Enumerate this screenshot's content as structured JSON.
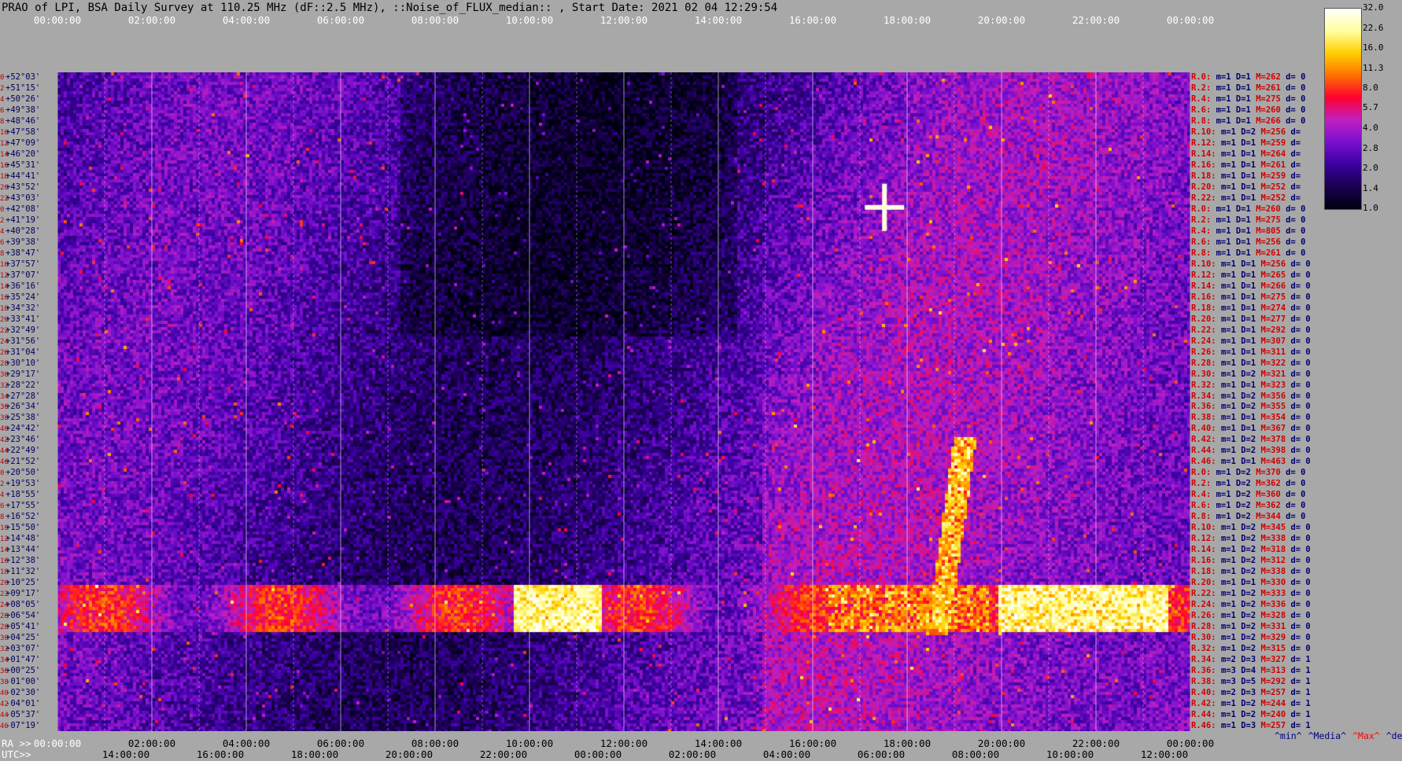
{
  "title": "PRAO of LPI, BSA Daily Survey at 110.25 MHz (dF::2.5 MHz), ::Noise_of_FLUX_median:: , Start Date: 2021 02 04 12:29:54",
  "chart_data": {
    "type": "heatmap",
    "top_ticks": [
      "00:00:00",
      "02:00:00",
      "04:00:00",
      "06:00:00",
      "08:00:00",
      "10:00:00",
      "12:00:00",
      "14:00:00",
      "16:00:00",
      "18:00:00",
      "20:00:00",
      "22:00:00",
      "00:00:00"
    ],
    "ra_prefix": "RA >>",
    "ra_ticks": [
      "00:00:00",
      "02:00:00",
      "04:00:00",
      "06:00:00",
      "08:00:00",
      "10:00:00",
      "12:00:00",
      "14:00:00",
      "16:00:00",
      "18:00:00",
      "20:00:00",
      "22:00:00",
      "00:00:00"
    ],
    "utc_prefix": "UTC>>",
    "utc_ticks": [
      "14:00:00",
      "16:00:00",
      "18:00:00",
      "20:00:00",
      "22:00:00",
      "00:00:00",
      "02:00:00",
      "04:00:00",
      "06:00:00",
      "08:00:00",
      "10:00:00",
      "12:00:00"
    ],
    "declinations": [
      "+52°03'",
      "+51°15'",
      "+50°26'",
      "+49°38'",
      "+48°46'",
      "+47°58'",
      "+47°09'",
      "+46°20'",
      "+45°31'",
      "+44°41'",
      "+43°52'",
      "+43°03'",
      "+42°08'",
      "+41°19'",
      "+40°28'",
      "+39°38'",
      "+38°47'",
      "+37°57'",
      "+37°07'",
      "+36°16'",
      "+35°24'",
      "+34°32'",
      "+33°41'",
      "+32°49'",
      "+31°56'",
      "+31°04'",
      "+30°10'",
      "+29°17'",
      "+28°22'",
      "+27°28'",
      "+26°34'",
      "+25°38'",
      "+24°42'",
      "+23°46'",
      "+22°49'",
      "+21°52'",
      "+20°50'",
      "+19°53'",
      "+18°55'",
      "+17°55'",
      "+16°52'",
      "+15°50'",
      "+14°48'",
      "+13°44'",
      "+12°38'",
      "+11°32'",
      "+10°25'",
      "+09°17'",
      "+08°05'",
      "+06°54'",
      "+05°41'",
      "+04°25'",
      "+03°07'",
      "+01°47'",
      "+00°25'",
      "-01°00'",
      "-02°30'",
      "-04°01'",
      "-05°37'",
      "-07°19'"
    ],
    "row_index": [
      "0",
      "2",
      "4",
      "6",
      "8",
      "10",
      "12",
      "14",
      "16",
      "18",
      "20",
      "22",
      "0",
      "2",
      "4",
      "6",
      "8",
      "10",
      "12",
      "14",
      "16",
      "18",
      "20",
      "22",
      "24",
      "26",
      "28",
      "30",
      "32",
      "34",
      "36",
      "38",
      "40",
      "42",
      "44",
      "46",
      "0",
      "2",
      "4",
      "6",
      "8",
      "10",
      "12",
      "14",
      "16",
      "18",
      "20",
      "22",
      "24",
      "26",
      "28",
      "30",
      "32",
      "34",
      "36",
      "38",
      "40",
      "42",
      "44",
      "46"
    ],
    "row_stats": [
      {
        "r": "R.0:",
        "m": "m=1",
        "D": "D=1",
        "M": "M=262",
        "d": "d= 0"
      },
      {
        "r": "R.2:",
        "m": "m=1",
        "D": "D=1",
        "M": "M=261",
        "d": "d= 0"
      },
      {
        "r": "R.4:",
        "m": "m=1",
        "D": "D=1",
        "M": "M=275",
        "d": "d= 0"
      },
      {
        "r": "R.6:",
        "m": "m=1",
        "D": "D=1",
        "M": "M=260",
        "d": "d= 0"
      },
      {
        "r": "R.8:",
        "m": "m=1",
        "D": "D=1",
        "M": "M=266",
        "d": "d= 0"
      },
      {
        "r": "R.10:",
        "m": "m=1",
        "D": "D=2",
        "M": "M=256",
        "d": "d="
      },
      {
        "r": "R.12:",
        "m": "m=1",
        "D": "D=1",
        "M": "M=259",
        "d": "d="
      },
      {
        "r": "R.14:",
        "m": "m=1",
        "D": "D=1",
        "M": "M=264",
        "d": "d="
      },
      {
        "r": "R.16:",
        "m": "m=1",
        "D": "D=1",
        "M": "M=261",
        "d": "d="
      },
      {
        "r": "R.18:",
        "m": "m=1",
        "D": "D=1",
        "M": "M=259",
        "d": "d="
      },
      {
        "r": "R.20:",
        "m": "m=1",
        "D": "D=1",
        "M": "M=252",
        "d": "d="
      },
      {
        "r": "R.22:",
        "m": "m=1",
        "D": "D=1",
        "M": "M=252",
        "d": "d="
      },
      {
        "r": "R.0:",
        "m": "m=1",
        "D": "D=1",
        "M": "M=260",
        "d": "d= 0"
      },
      {
        "r": "R.2:",
        "m": "m=1",
        "D": "D=1",
        "M": "M=275",
        "d": "d= 0"
      },
      {
        "r": "R.4:",
        "m": "m=1",
        "D": "D=1",
        "M": "M=805",
        "d": "d= 0"
      },
      {
        "r": "R.6:",
        "m": "m=1",
        "D": "D=1",
        "M": "M=256",
        "d": "d= 0"
      },
      {
        "r": "R.8:",
        "m": "m=1",
        "D": "D=1",
        "M": "M=261",
        "d": "d= 0"
      },
      {
        "r": "R.10:",
        "m": "m=1",
        "D": "D=1",
        "M": "M=256",
        "d": "d= 0"
      },
      {
        "r": "R.12:",
        "m": "m=1",
        "D": "D=1",
        "M": "M=265",
        "d": "d= 0"
      },
      {
        "r": "R.14:",
        "m": "m=1",
        "D": "D=1",
        "M": "M=266",
        "d": "d= 0"
      },
      {
        "r": "R.16:",
        "m": "m=1",
        "D": "D=1",
        "M": "M=275",
        "d": "d= 0"
      },
      {
        "r": "R.18:",
        "m": "m=1",
        "D": "D=1",
        "M": "M=274",
        "d": "d= 0"
      },
      {
        "r": "R.20:",
        "m": "m=1",
        "D": "D=1",
        "M": "M=277",
        "d": "d= 0"
      },
      {
        "r": "R.22:",
        "m": "m=1",
        "D": "D=1",
        "M": "M=292",
        "d": "d= 0"
      },
      {
        "r": "R.24:",
        "m": "m=1",
        "D": "D=1",
        "M": "M=307",
        "d": "d= 0"
      },
      {
        "r": "R.26:",
        "m": "m=1",
        "D": "D=1",
        "M": "M=311",
        "d": "d= 0"
      },
      {
        "r": "R.28:",
        "m": "m=1",
        "D": "D=1",
        "M": "M=322",
        "d": "d= 0"
      },
      {
        "r": "R.30:",
        "m": "m=1",
        "D": "D=2",
        "M": "M=321",
        "d": "d= 0"
      },
      {
        "r": "R.32:",
        "m": "m=1",
        "D": "D=1",
        "M": "M=323",
        "d": "d= 0"
      },
      {
        "r": "R.34:",
        "m": "m=1",
        "D": "D=2",
        "M": "M=356",
        "d": "d= 0"
      },
      {
        "r": "R.36:",
        "m": "m=1",
        "D": "D=2",
        "M": "M=355",
        "d": "d= 0"
      },
      {
        "r": "R.38:",
        "m": "m=1",
        "D": "D=1",
        "M": "M=354",
        "d": "d= 0"
      },
      {
        "r": "R.40:",
        "m": "m=1",
        "D": "D=1",
        "M": "M=367",
        "d": "d= 0"
      },
      {
        "r": "R.42:",
        "m": "m=1",
        "D": "D=2",
        "M": "M=378",
        "d": "d= 0"
      },
      {
        "r": "R.44:",
        "m": "m=1",
        "D": "D=2",
        "M": "M=398",
        "d": "d= 0"
      },
      {
        "r": "R.46:",
        "m": "m=1",
        "D": "D=1",
        "M": "M=463",
        "d": "d= 0"
      },
      {
        "r": "R.0:",
        "m": "m=1",
        "D": "D=2",
        "M": "M=370",
        "d": "d= 0"
      },
      {
        "r": "R.2:",
        "m": "m=1",
        "D": "D=2",
        "M": "M=362",
        "d": "d= 0"
      },
      {
        "r": "R.4:",
        "m": "m=1",
        "D": "D=2",
        "M": "M=360",
        "d": "d= 0"
      },
      {
        "r": "R.6:",
        "m": "m=1",
        "D": "D=2",
        "M": "M=362",
        "d": "d= 0"
      },
      {
        "r": "R.8:",
        "m": "m=1",
        "D": "D=2",
        "M": "M=344",
        "d": "d= 0"
      },
      {
        "r": "R.10:",
        "m": "m=1",
        "D": "D=2",
        "M": "M=345",
        "d": "d= 0"
      },
      {
        "r": "R.12:",
        "m": "m=1",
        "D": "D=2",
        "M": "M=338",
        "d": "d= 0"
      },
      {
        "r": "R.14:",
        "m": "m=1",
        "D": "D=2",
        "M": "M=318",
        "d": "d= 0"
      },
      {
        "r": "R.16:",
        "m": "m=1",
        "D": "D=2",
        "M": "M=312",
        "d": "d= 0"
      },
      {
        "r": "R.18:",
        "m": "m=1",
        "D": "D=2",
        "M": "M=338",
        "d": "d= 0"
      },
      {
        "r": "R.20:",
        "m": "m=1",
        "D": "D=1",
        "M": "M=330",
        "d": "d= 0"
      },
      {
        "r": "R.22:",
        "m": "m=1",
        "D": "D=2",
        "M": "M=333",
        "d": "d= 0"
      },
      {
        "r": "R.24:",
        "m": "m=1",
        "D": "D=2",
        "M": "M=336",
        "d": "d= 0"
      },
      {
        "r": "R.26:",
        "m": "m=1",
        "D": "D=2",
        "M": "M=328",
        "d": "d= 0"
      },
      {
        "r": "R.28:",
        "m": "m=1",
        "D": "D=2",
        "M": "M=331",
        "d": "d= 0"
      },
      {
        "r": "R.30:",
        "m": "m=1",
        "D": "D=2",
        "M": "M=329",
        "d": "d= 0"
      },
      {
        "r": "R.32:",
        "m": "m=1",
        "D": "D=2",
        "M": "M=315",
        "d": "d= 0"
      },
      {
        "r": "R.34:",
        "m": "m=2",
        "D": "D=3",
        "M": "M=327",
        "d": "d= 1"
      },
      {
        "r": "R.36:",
        "m": "m=3",
        "D": "D=4",
        "M": "M=313",
        "d": "d= 1"
      },
      {
        "r": "R.38:",
        "m": "m=3",
        "D": "D=5",
        "M": "M=292",
        "d": "d= 1"
      },
      {
        "r": "R.40:",
        "m": "m=2",
        "D": "D=3",
        "M": "M=257",
        "d": "d= 1"
      },
      {
        "r": "R.42:",
        "m": "m=1",
        "D": "D=2",
        "M": "M=244",
        "d": "d= 1"
      },
      {
        "r": "R.44:",
        "m": "m=1",
        "D": "D=2",
        "M": "M=240",
        "d": "d= 1"
      },
      {
        "r": "R.46:",
        "m": "m=1",
        "D": "D=3",
        "M": "M=257",
        "d": "d= 1"
      }
    ],
    "colorbar_ticks": [
      "32.0",
      "22.6",
      "16.0",
      "11.3",
      "8.0",
      "5.7",
      "4.0",
      "2.8",
      "2.0",
      "1.4",
      "1.0"
    ],
    "colorbar_values": [
      32.0,
      22.6,
      16.0,
      11.3,
      8.0,
      5.7,
      4.0,
      2.8,
      2.0,
      1.4,
      1.0
    ],
    "colorscale": "log",
    "colors": [
      "#000010",
      "#1a0050",
      "#3a00a0",
      "#7a10d0",
      "#c020c0",
      "#ff0030",
      "#ff7000",
      "#ffd000",
      "#ffffa0",
      "#ffffff"
    ],
    "legend_keys": [
      {
        "label": "^min^",
        "color": "#000080"
      },
      {
        "label": "^Media^",
        "color": "#000080"
      },
      {
        "label": "^Max^",
        "color": "#ff0000"
      },
      {
        "label": "^devia^",
        "color": "#000080"
      }
    ]
  }
}
